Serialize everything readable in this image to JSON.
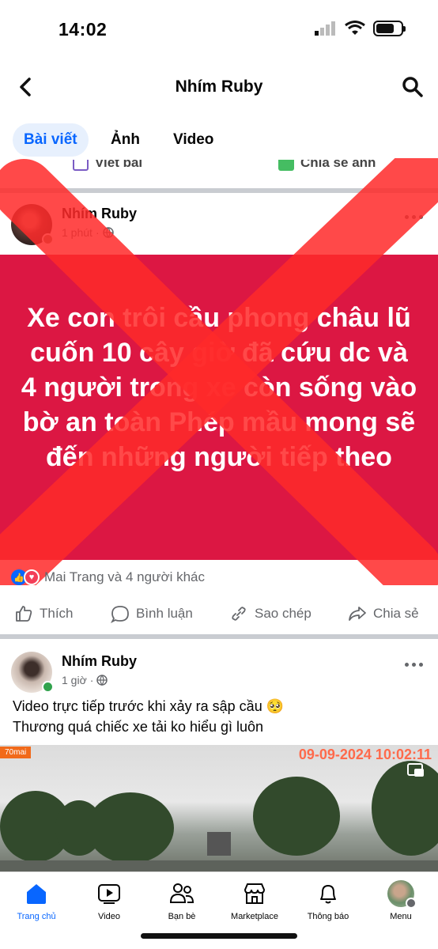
{
  "status_bar": {
    "time": "14:02"
  },
  "header": {
    "title": "Nhím Ruby"
  },
  "tabs": [
    {
      "label": "Bài viết"
    },
    {
      "label": "Ảnh"
    },
    {
      "label": "Video"
    }
  ],
  "creator": {
    "write_post": "Viết bài",
    "share_photo": "Chia sẻ ảnh"
  },
  "post1": {
    "author": "Nhím Ruby",
    "time": "1 phút",
    "text": "Xe con trôi cầu phong châu lũ cuốn 10 cây giờ đã cứu dc và 4 người trong xe còn sống vào bờ an toàn Phép mầu mong sẽ đến những người tiếp theo",
    "card_color": "#dc1743",
    "reactions_text": "Mai Trang và 4 người khác",
    "actions": {
      "like": "Thích",
      "comment": "Bình luận",
      "copy": "Sao chép",
      "share": "Chia sẻ"
    }
  },
  "post2": {
    "author": "Nhím Ruby",
    "time": "1 giờ",
    "caption_line1": "Video trực tiếp trước khi xảy ra sập cầu 🥺",
    "caption_line2": "Thương quá chiếc xe tải ko hiểu gì luôn",
    "video_tag": "70mai",
    "video_timestamp": "09-09-2024 10:02:11"
  },
  "bottom_nav": [
    {
      "label": "Trang chủ",
      "icon": "home-icon",
      "active": true
    },
    {
      "label": "Video",
      "icon": "video-icon"
    },
    {
      "label": "Bạn bè",
      "icon": "friends-icon"
    },
    {
      "label": "Marketplace",
      "icon": "marketplace-icon"
    },
    {
      "label": "Thông báo",
      "icon": "bell-icon"
    },
    {
      "label": "Menu",
      "icon": "menu-avatar-icon"
    }
  ],
  "colors": {
    "accent": "#0866ff",
    "warning_x": "#ff2a2a"
  }
}
